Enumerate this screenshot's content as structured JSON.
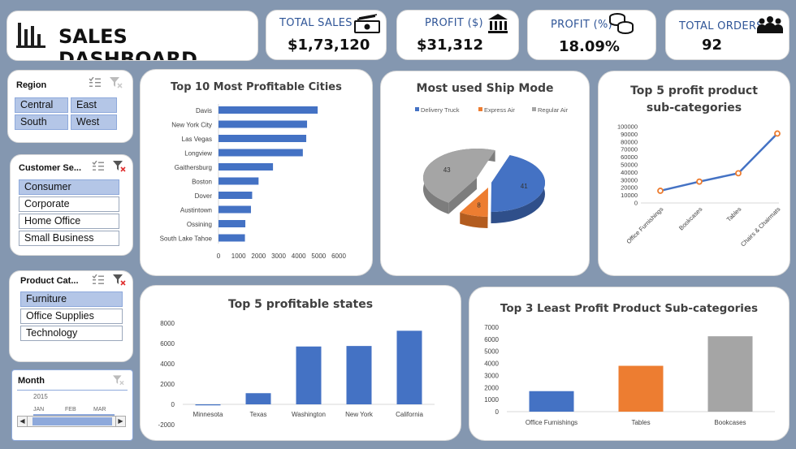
{
  "header": {
    "title": "SALES DASHBOARD"
  },
  "kpis": [
    {
      "label": "TOTAL SALES",
      "value": "$1,73,120",
      "icon": "cash-icon"
    },
    {
      "label": "PROFIT ($)",
      "value": "$31,312",
      "icon": "bank-icon"
    },
    {
      "label": "PROFIT (%)",
      "value": "18.09%",
      "icon": "coins-icon"
    },
    {
      "label": "TOTAL ORDERS",
      "value": "92",
      "icon": "people-icon"
    }
  ],
  "slicers": {
    "region": {
      "title": "Region",
      "items": [
        "Central",
        "East",
        "South",
        "West"
      ]
    },
    "segment": {
      "title": "Customer Se...",
      "items": [
        "Consumer",
        "Corporate",
        "Home Office",
        "Small Business"
      ]
    },
    "category": {
      "title": "Product Cat...",
      "items": [
        "Furniture",
        "Office Supplies",
        "Technology"
      ]
    },
    "month": {
      "title": "Month",
      "year": "2015",
      "months": [
        "JAN",
        "FEB",
        "MAR"
      ]
    }
  },
  "colors": {
    "blue": "#4472c4",
    "orange": "#ed7d31",
    "gray": "#a5a5a5",
    "kpi_label": "#2f5597",
    "background": "#8497b0"
  },
  "chart_data": [
    {
      "type": "bar",
      "orientation": "horizontal",
      "title": "Top 10 Most Profitable Cities",
      "categories": [
        "Davis",
        "New York City",
        "Las Vegas",
        "Longview",
        "Gaithersburg",
        "Boston",
        "Dover",
        "Austintown",
        "Ossining",
        "South Lake Tahoe"
      ],
      "values": [
        4950,
        4420,
        4380,
        4210,
        2720,
        2000,
        1680,
        1620,
        1340,
        1320
      ],
      "xlim": [
        0,
        6000
      ],
      "xticks": [
        "0",
        "1000",
        "2000",
        "3000",
        "4000",
        "5000",
        "6000"
      ]
    },
    {
      "type": "pie",
      "title": "Most used Ship Mode",
      "categories": [
        "Delivery Truck",
        "Express Air",
        "Regular Air"
      ],
      "values": [
        41,
        8,
        43
      ],
      "legend": "top"
    },
    {
      "type": "line",
      "title": "Top 5 profit product sub-categories",
      "categories": [
        "Office Furnishings",
        "Bookcases",
        "Tables",
        "Chairs & Chairmats"
      ],
      "values": [
        16000,
        28000,
        39000,
        91000
      ],
      "ylim": [
        0,
        100000
      ],
      "yticks": [
        "0",
        "10000",
        "20000",
        "30000",
        "40000",
        "50000",
        "60000",
        "70000",
        "80000",
        "90000",
        "100000"
      ]
    },
    {
      "type": "bar",
      "title": "Top 5 profitable states",
      "categories": [
        "Minnesota",
        "Texas",
        "Washington",
        "New York",
        "California"
      ],
      "values": [
        -100,
        1100,
        5700,
        5750,
        7250
      ],
      "ylim": [
        -2000,
        8000
      ],
      "yticks": [
        "-2000",
        "0",
        "2000",
        "4000",
        "6000",
        "8000"
      ]
    },
    {
      "type": "bar",
      "title": "Top 3 Least Profit Product Sub-categories",
      "categories": [
        "Office Furnishings",
        "Tables",
        "Bookcases"
      ],
      "values": [
        1700,
        3800,
        6250
      ],
      "colors": [
        "#4472c4",
        "#ed7d31",
        "#a5a5a5"
      ],
      "ylim": [
        0,
        7000
      ],
      "yticks": [
        "0",
        "1000",
        "2000",
        "3000",
        "4000",
        "5000",
        "6000",
        "7000"
      ]
    }
  ]
}
